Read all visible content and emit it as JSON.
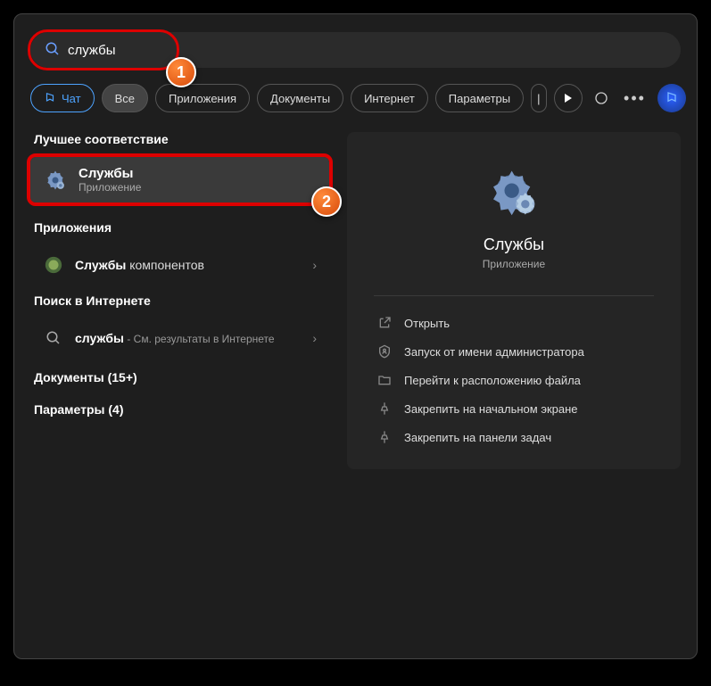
{
  "search": {
    "value": "службы"
  },
  "filters": {
    "chat": "Чат",
    "all": "Все",
    "apps": "Приложения",
    "docs": "Документы",
    "web": "Интернет",
    "params": "Параметры"
  },
  "left": {
    "bestMatchHeader": "Лучшее соответствие",
    "bestMatch": {
      "title": "Службы",
      "subtitle": "Приложение"
    },
    "appsHeader": "Приложения",
    "componentServices": {
      "bold": "Службы",
      "rest": " компонентов"
    },
    "webHeader": "Поиск в Интернете",
    "webResult": {
      "bold": "службы",
      "rest": " - См. результаты в Интернете"
    },
    "docsHeader": "Документы (15+)",
    "paramsHeader": "Параметры (4)"
  },
  "detail": {
    "title": "Службы",
    "subtitle": "Приложение",
    "actions": {
      "open": "Открыть",
      "admin": "Запуск от имени администратора",
      "location": "Перейти к расположению файла",
      "pinStart": "Закрепить на начальном экране",
      "pinTaskbar": "Закрепить на панели задач"
    }
  },
  "annotations": {
    "step1": "1",
    "step2": "2"
  }
}
